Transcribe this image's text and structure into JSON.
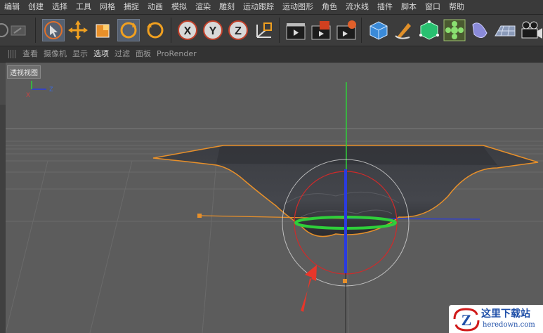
{
  "menu": [
    "编辑",
    "创建",
    "选择",
    "工具",
    "网格",
    "捕捉",
    "动画",
    "模拟",
    "渲染",
    "雕刻",
    "运动跟踪",
    "运动图形",
    "角色",
    "流水线",
    "插件",
    "脚本",
    "窗口",
    "帮助"
  ],
  "toolbar": {
    "icons": [
      "undo-icon",
      "select-arrow-icon",
      "move-icon",
      "scale-icon",
      "rotate-icon",
      "recent-tool-icon",
      "x-axis-lock-icon",
      "y-axis-lock-icon",
      "z-axis-lock-icon",
      "coordinate-system-icon",
      "render-view-icon",
      "render-picture-viewer-icon",
      "render-settings-icon",
      "cube-icon",
      "pen-spline-icon",
      "subdivision-icon",
      "cloner-icon",
      "deformer-icon",
      "floor-icon",
      "camera-icon"
    ],
    "axis_letters": [
      "X",
      "Y",
      "Z"
    ]
  },
  "view_menu": {
    "items": [
      "查看",
      "摄像机",
      "显示",
      "选项",
      "过滤",
      "面板",
      "ProRender"
    ],
    "active": "选项"
  },
  "viewport": {
    "label": "透视视图",
    "axis_labels": {
      "x": "X",
      "y": "Y",
      "z": "Z"
    }
  },
  "colors": {
    "selection_orange": "#e8902a",
    "axis_red": "#d02a2a",
    "axis_green": "#2fcf3a",
    "axis_blue": "#2a3be0",
    "annotation_arrow": "#e8362a"
  },
  "watermark": {
    "logo_letter": "Z",
    "title": "这里下载站",
    "url": "heredown.com"
  }
}
